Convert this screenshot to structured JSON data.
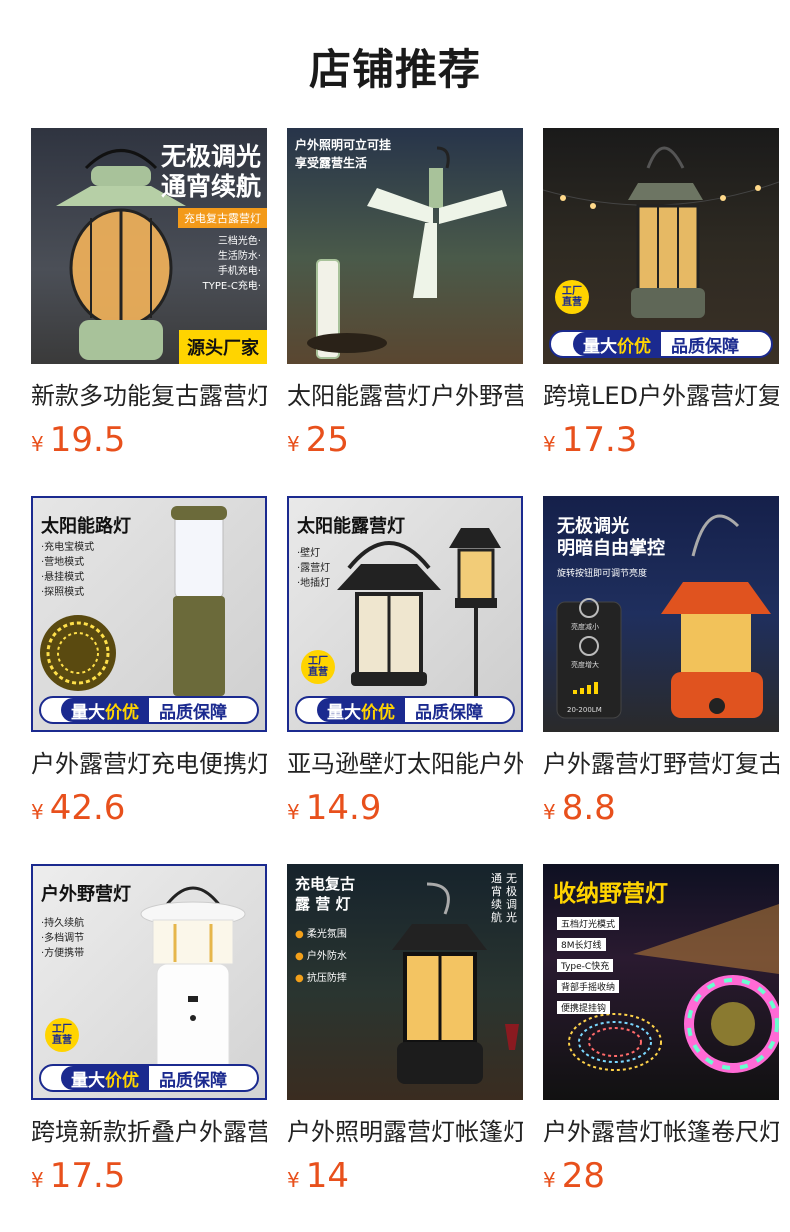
{
  "page": {
    "title": "店铺推荐"
  },
  "products": [
    {
      "name": "新款多功能复古露营灯",
      "price": "19.5",
      "currency": "¥",
      "image": {
        "headline": [
          "无极调光",
          "通宵续航"
        ],
        "ribbon": "充电复古露营灯",
        "features": [
          "三档光色·",
          "生活防水·",
          "手机充电·",
          "TYPE-C充电·"
        ],
        "tag": "源头厂家"
      }
    },
    {
      "name": "太阳能露营灯户外野营灯",
      "price": "25",
      "currency": "¥",
      "image": {
        "headline": [
          "户外照明可立可挂",
          "享受露营生活"
        ]
      }
    },
    {
      "name": "跨境LED户外露营灯复古",
      "price": "17.3",
      "currency": "¥",
      "image": {
        "badge": [
          "工厂",
          "直营"
        ],
        "banner_strong": "量大",
        "banner_highlight": "价优",
        "banner_rest": "品质保障"
      }
    },
    {
      "name": "户外露营灯充电便携灯",
      "price": "42.6",
      "currency": "¥",
      "image": {
        "headline": [
          "太阳能路灯"
        ],
        "features": [
          "·充电宝模式",
          "·营地模式",
          "·悬挂模式",
          "·探照模式"
        ],
        "banner_strong": "量大",
        "banner_highlight": "价优",
        "banner_rest": "品质保障"
      }
    },
    {
      "name": "亚马逊壁灯太阳能户外",
      "price": "14.9",
      "currency": "¥",
      "image": {
        "headline": [
          "太阳能露营灯"
        ],
        "features": [
          "·壁灯",
          "·露营灯",
          "·地插灯"
        ],
        "badge": [
          "工厂",
          "直营"
        ],
        "banner_strong": "量大",
        "banner_highlight": "价优",
        "banner_rest": "品质保障"
      }
    },
    {
      "name": "户外露营灯野营灯复古",
      "price": "8.8",
      "currency": "¥",
      "image": {
        "headline": [
          "无极调光",
          "明暗自由掌控"
        ],
        "subline": "旋转按钮即可调节亮度",
        "knob_labels": [
          "亮度减小",
          "亮度增大"
        ],
        "range": "20-200LM"
      }
    },
    {
      "name": "跨境新款折叠户外露营灯",
      "price": "17.5",
      "currency": "¥",
      "image": {
        "headline": [
          "户外野营灯"
        ],
        "features": [
          "·持久续航",
          "·多档调节",
          "·方便携带"
        ],
        "badge": [
          "工厂",
          "直营"
        ],
        "banner_strong": "量大",
        "banner_highlight": "价优",
        "banner_rest": "品质保障"
      }
    },
    {
      "name": "户外照明露营灯帐篷灯",
      "price": "14",
      "currency": "¥",
      "image": {
        "headline": [
          "充电复古",
          "露 营 灯"
        ],
        "vertical": [
          "无极调光",
          "通宵续航"
        ],
        "features": [
          "柔光氛围",
          "户外防水",
          "抗压防摔"
        ]
      }
    },
    {
      "name": "户外露营灯帐篷卷尺灯",
      "price": "28",
      "currency": "¥",
      "image": {
        "headline": [
          "收纳野营灯"
        ],
        "features": [
          "五档灯光模式",
          "8M长灯线",
          "Type-C快充",
          "背部手摇收纳",
          "便携提挂钩"
        ]
      }
    }
  ],
  "colors": {
    "price": "#e8501c",
    "banner_blue": "#1b2a8f",
    "badge_yellow": "#ffd400"
  }
}
